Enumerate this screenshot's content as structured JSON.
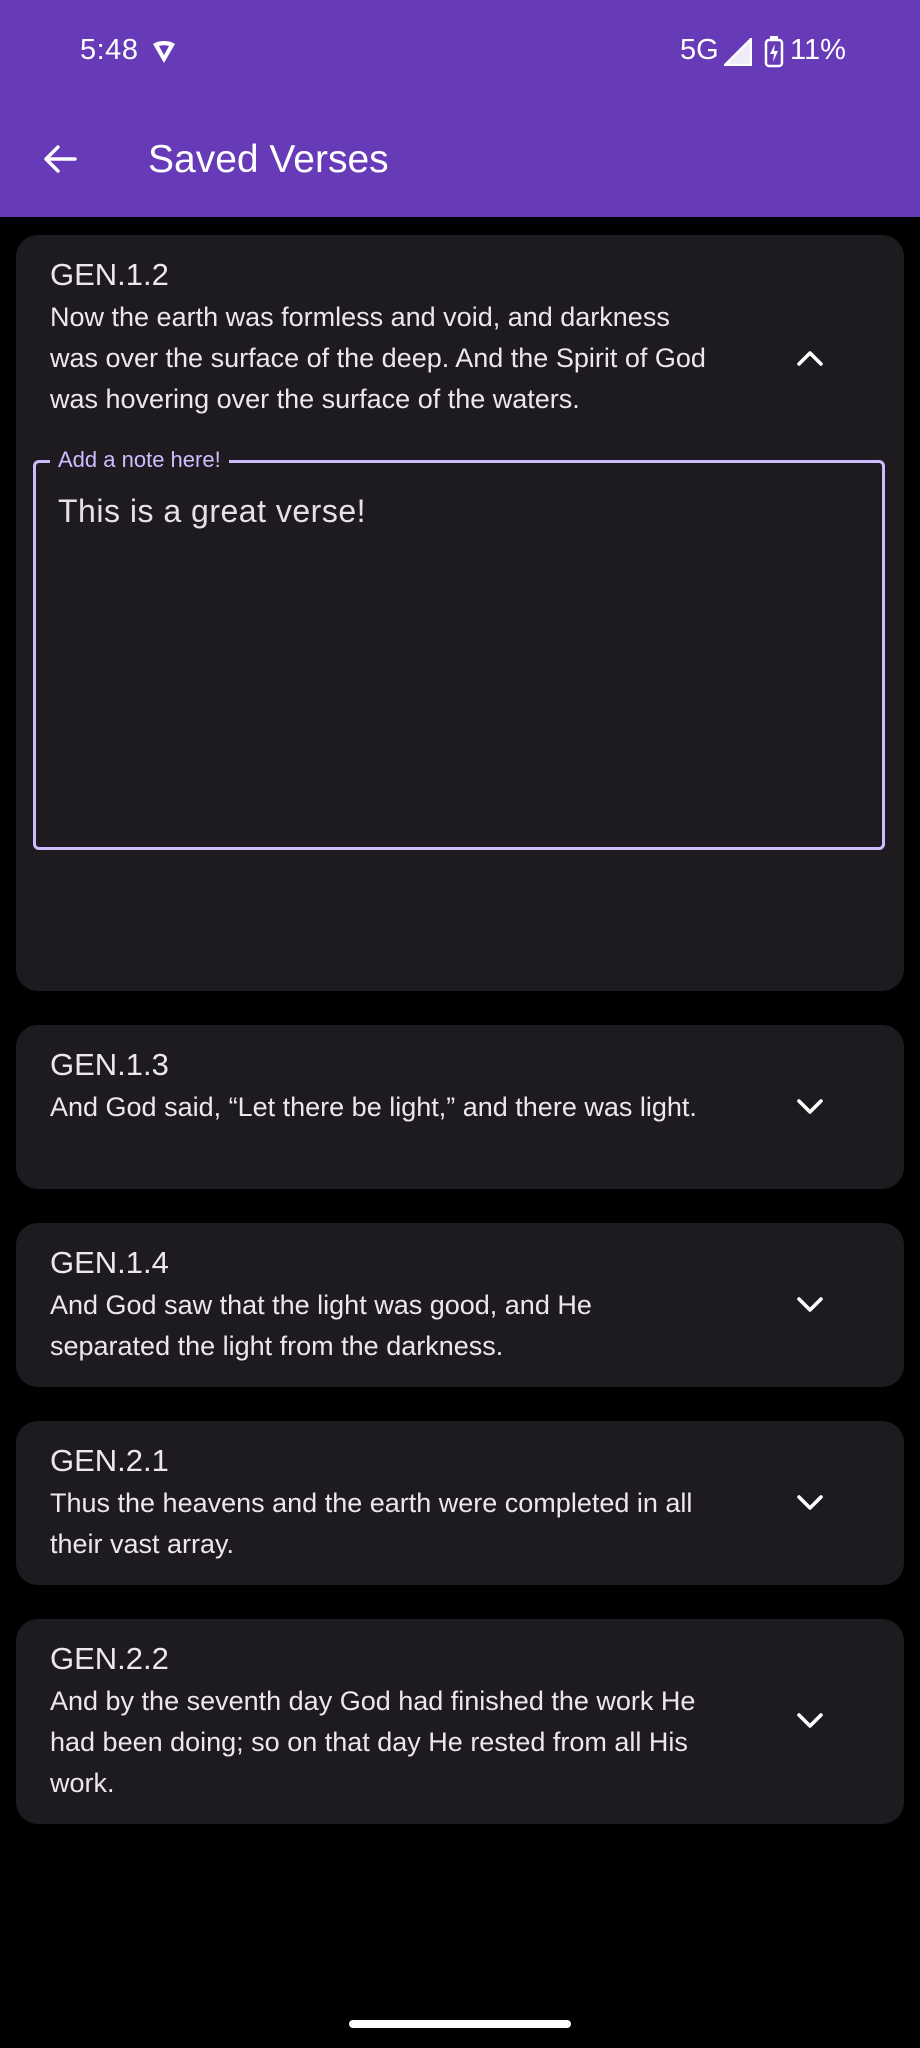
{
  "status_bar": {
    "time": "5:48",
    "network": "5G",
    "battery": "11%",
    "vpn_icon": "vpn-shield-icon",
    "signal_icon": "cell-signal-icon",
    "battery_icon": "battery-charging-icon"
  },
  "app_bar": {
    "title": "Saved Verses",
    "back_icon": "arrow-back-icon",
    "background": "#673AB7"
  },
  "verses": [
    {
      "ref": "GEN.1.2",
      "text": "Now the earth was formless and void, and darkness was over the surface of the deep. And the Spirit of God was hovering over the surface of the waters.",
      "expanded": true,
      "note_label": "Add a note here!",
      "note_value": "This is a great verse!"
    },
    {
      "ref": "GEN.1.3",
      "text": "And God said, “Let there be light,” and there was light.",
      "expanded": false
    },
    {
      "ref": "GEN.1.4",
      "text": "And God saw that the light was good, and He separated the light from the darkness.",
      "expanded": false
    },
    {
      "ref": "GEN.2.1",
      "text": "Thus the heavens and the earth were completed in all their vast array.",
      "expanded": false
    },
    {
      "ref": "GEN.2.2",
      "text": "And by the seventh day God had finished the work He had been doing; so on that day He rested from all His work.",
      "expanded": false
    }
  ],
  "colors": {
    "card": "#1D1B20",
    "accent": "#CFBCFF",
    "background": "#000000"
  }
}
